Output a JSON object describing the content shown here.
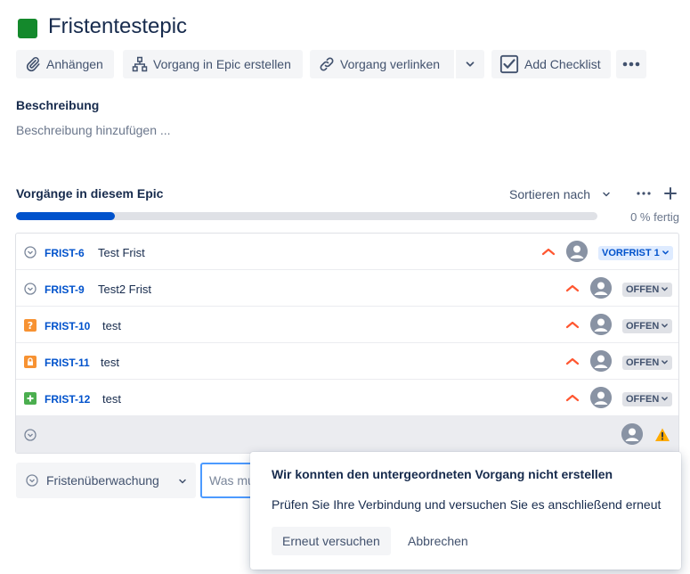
{
  "header": {
    "title": "Fristentestepic",
    "epic_color": "#14892c"
  },
  "toolbar": {
    "attach_label": "Anhängen",
    "create_in_epic_label": "Vorgang in Epic erstellen",
    "link_issue_label": "Vorgang verlinken",
    "add_checklist_label": "Add Checklist"
  },
  "description": {
    "heading": "Beschreibung",
    "placeholder": "Beschreibung hinzufügen ..."
  },
  "issues_section": {
    "heading": "Vorgänge in diesem Epic",
    "sort_label": "Sortieren nach",
    "progress_text": "0 % fertig",
    "progress_fraction": 0.17
  },
  "issues": [
    {
      "key": "FRIST-6",
      "summary": "Test Frist",
      "type": "gray-circle",
      "status": "VORFRIST 1",
      "status_style": "blue"
    },
    {
      "key": "FRIST-9",
      "summary": "Test2 Frist",
      "type": "gray-circle",
      "status": "OFFEN",
      "status_style": "gray"
    },
    {
      "key": "FRIST-10",
      "summary": "test",
      "type": "question-orange",
      "status": "OFFEN",
      "status_style": "gray"
    },
    {
      "key": "FRIST-11",
      "summary": "test",
      "type": "lock-orange",
      "status": "OFFEN",
      "status_style": "gray"
    },
    {
      "key": "FRIST-12",
      "summary": "test",
      "type": "plus-green",
      "status": "OFFEN",
      "status_style": "gray"
    }
  ],
  "create_bar": {
    "type_label": "Fristenüberwachung",
    "input_placeholder": "Was muss erledigt werden?"
  },
  "error_popup": {
    "title": "Wir konnten den untergeordneten Vorgang nicht erstellen",
    "message": "Prüfen Sie Ihre Verbindung und versuchen Sie es anschließend erneut",
    "retry_label": "Erneut versuchen",
    "cancel_label": "Abbrechen"
  },
  "colors": {
    "link": "#0052cc",
    "priority": "#ff5630",
    "warning": "#ffab00"
  }
}
